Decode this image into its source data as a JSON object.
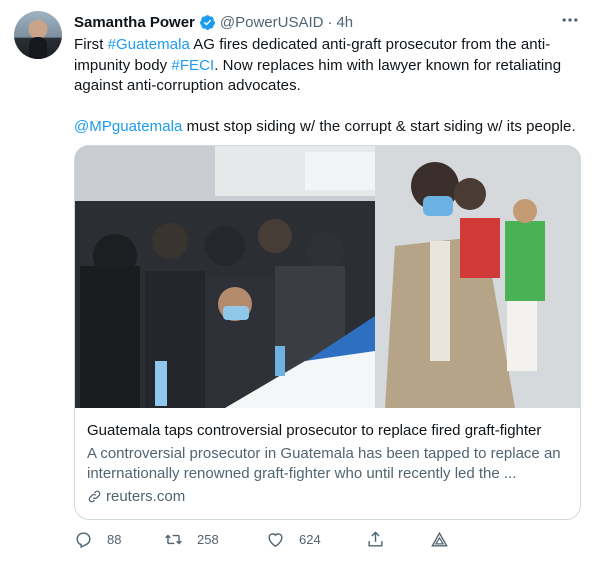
{
  "author": {
    "name": "Samantha Power",
    "handle": "@PowerUSAID",
    "dot": "·",
    "time": "4h"
  },
  "tweet": {
    "p1_pre": "First ",
    "p1_tag1": "#Guatemala",
    "p1_mid": " AG fires dedicated anti-graft prosecutor from the anti-impunity body ",
    "p1_tag2": "#FECI",
    "p1_post": ". Now replaces him with lawyer known for retaliating against anti-corruption advocates.",
    "p2_mention": "@MPguatemala",
    "p2_post": " must stop siding w/ the corrupt & start siding w/ its people."
  },
  "card": {
    "title": "Guatemala taps controversial prosecutor to replace fired graft-fighter",
    "description": "A controversial prosecutor in Guatemala has been tapped to replace an internationally renowned graft-fighter who until recently led the ...",
    "domain": "reuters.com"
  },
  "actions": {
    "replies": "88",
    "retweets": "258",
    "likes": "624"
  },
  "colors": {
    "accent": "#1d9bf0",
    "muted": "#536471",
    "text": "#0f1419"
  },
  "icons": [
    "verified-badge-icon",
    "more-options-icon",
    "link-icon",
    "reply-icon",
    "retweet-icon",
    "like-icon",
    "share-icon",
    "analytics-icon"
  ]
}
